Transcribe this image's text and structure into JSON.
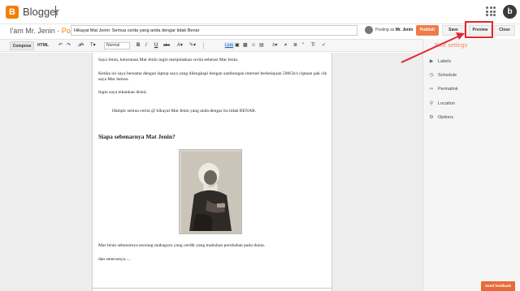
{
  "app": {
    "logo_letter": "B",
    "name": "Blogger",
    "avatar_letter": "b"
  },
  "post": {
    "blog_name": "I'am Mr. Jenin",
    "separator": " · ",
    "post_label": "Post",
    "title_value": "Hikayat Mat Jenin: Semua cerita yang anda dengar tidak Benar",
    "posting_as_label": "Posting as",
    "posting_as_user": "Mr. Jenin"
  },
  "actions": {
    "publish": "Publish",
    "save": "Save",
    "preview": "Preview",
    "close": "Close"
  },
  "toolbar": {
    "compose": "Compose",
    "html": "HTML",
    "undo_icon": "undo-icon",
    "redo_icon": "redo-icon",
    "font_size_value": "Normal",
    "link_label": "Link"
  },
  "sidebar": {
    "heading": "Post settings",
    "items": [
      {
        "label": "Labels",
        "icon": "tag-icon"
      },
      {
        "label": "Schedule",
        "icon": "clock-icon"
      },
      {
        "label": "Permalink",
        "icon": "link-icon"
      },
      {
        "label": "Location",
        "icon": "pin-icon"
      },
      {
        "label": "Options",
        "icon": "gear-icon"
      }
    ]
  },
  "content": {
    "p1": "Saya Jenin, keturunan Mat Jenin ingin menjelaskan cerita sebenar Mat Jenin.",
    "p2": "Ketika ini saya bersama dengan laptop saya yang dilengkapi dengan sambungan internet berkelajuan 500Gb/s ciptaan pak cik saya Mat Jamon.",
    "p3": "Ingin saya tekankan disini:",
    "quote": "Hampir semua cerita @ hikayat Mat Jenin yang anda dengar itu tidak BENAR.",
    "heading": "Siapa sebenarnya Mat Jenin?",
    "p4": "Mat Jenin sebenarnya seorang mahaguru yang cerdik yang mahukan perubahan pada dunia.",
    "p5": "dan seterusnya....."
  },
  "feedback": "Send feedback",
  "colors": {
    "accent": "#f57d00",
    "publish": "#f07b4a",
    "highlight": "#e3262f"
  }
}
